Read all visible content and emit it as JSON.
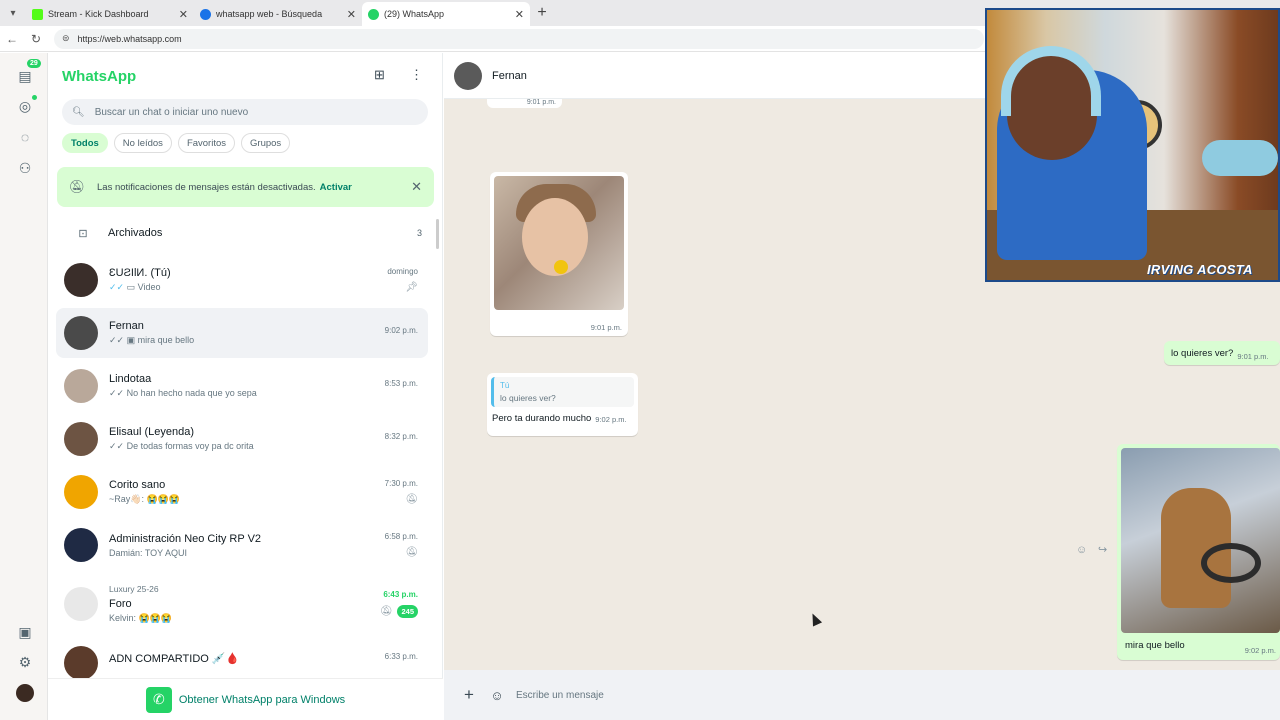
{
  "browser": {
    "tabs": [
      {
        "title": "Stream - Kick Dashboard",
        "favicon_color": "#53fc18"
      },
      {
        "title": "whatsapp web - Búsqueda",
        "favicon_color": "#1a73e8"
      },
      {
        "title": "(29) WhatsApp",
        "favicon_color": "#25d366"
      }
    ],
    "url": "https://web.whatsapp.com"
  },
  "rail": {
    "chats_badge": "29"
  },
  "sidebar": {
    "brand": "WhatsApp",
    "search_placeholder": "Buscar un chat o iniciar uno nuevo",
    "filters": [
      "Todos",
      "No leídos",
      "Favoritos",
      "Grupos"
    ],
    "notice": {
      "text": "Las notificaciones de mensajes están desactivadas.",
      "action": "Activar"
    },
    "archived": {
      "label": "Archivados",
      "count": "3"
    },
    "chats": [
      {
        "name": "ƐUƧIƖИ. (Tú)",
        "preview": "Video",
        "time": "domingo",
        "avatar_color": "#3a2e2a"
      },
      {
        "name": "Fernan",
        "preview": "mira que bello",
        "time": "9:02 p.m.",
        "avatar_color": "#4a4a4a"
      },
      {
        "name": "Lindotaa",
        "preview": "No han hecho nada que yo sepa",
        "time": "8:53 p.m.",
        "avatar_color": "#b9a89a"
      },
      {
        "name": "Elisaul (Leyenda)",
        "preview": "De todas formas voy pa dc orita",
        "time": "8:32 p.m.",
        "avatar_color": "#6d5443"
      },
      {
        "name": "Corito sano",
        "preview": "~Ray👋🏻: 😭😭😭",
        "time": "7:30 p.m.",
        "avatar_color": "#f0a500"
      },
      {
        "name": "Administración Neo City RP V2",
        "preview": "Damián: TOY AQUI",
        "time": "6:58 p.m.",
        "avatar_color": "#1f2a44"
      },
      {
        "name": "Foro",
        "prefix": "Luxury 25-26",
        "preview": "Kelvin: 😭😭😭",
        "time": "6:43 p.m.",
        "unread": "245",
        "avatar_color": "#e8e8e8"
      },
      {
        "name": "ADN COMPARTIDO 💉🩸",
        "preview": "",
        "time": "6:33 p.m.",
        "avatar_color": "#5b3b2b"
      }
    ],
    "get_windows": "Obtener WhatsApp para Windows"
  },
  "conversation": {
    "contact": "Fernan",
    "messages": [
      {
        "time": "9:01 p.m."
      },
      {
        "time": "9:01 p.m."
      },
      {
        "text": "lo quieres ver?",
        "time": "9:01 p.m."
      },
      {
        "quote_author": "Tú",
        "quote_text": "lo quieres ver?",
        "text": "Pero ta durando mucho",
        "time": "9:02 p.m."
      },
      {
        "caption": "mira que bello",
        "time": "9:02 p.m."
      }
    ],
    "composer_placeholder": "Escribe un mensaje"
  },
  "overlay": {
    "streamer_name": "IRVING ACOSTA"
  }
}
